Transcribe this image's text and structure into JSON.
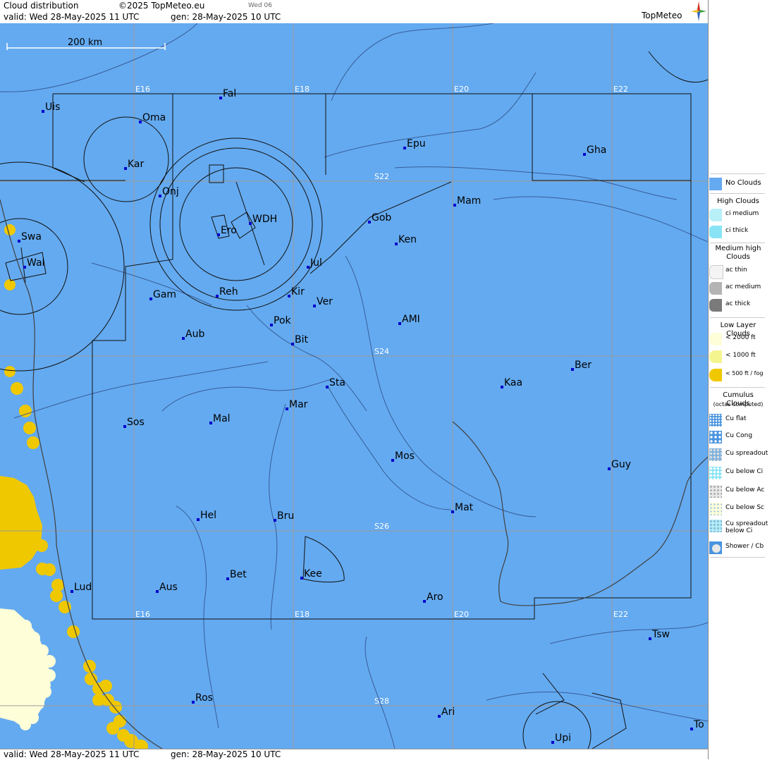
{
  "header": {
    "title": "Cloud distribution",
    "copyright": "©2025 TopMeteo.eu",
    "day_tag": "Wed 06",
    "valid": "valid:  Wed  28-May-2025  11 UTC",
    "gen": "gen: 28-May-2025 10 UTC",
    "logo": "TopMeteo"
  },
  "footer": {
    "valid": "valid:  Wed  28-May-2025  11 UTC",
    "gen": "gen: 28-May-2025 10 UTC"
  },
  "map": {
    "scale_label": "200 km",
    "grid_labels": {
      "lon": [
        "E16",
        "E18",
        "E20",
        "E22"
      ],
      "lat": [
        "S22",
        "S24",
        "S26",
        "S28"
      ]
    },
    "cities": [
      {
        "name": "Uis"
      },
      {
        "name": "Fal"
      },
      {
        "name": "Oma"
      },
      {
        "name": "Epu"
      },
      {
        "name": "Gha"
      },
      {
        "name": "Kar"
      },
      {
        "name": "Onj"
      },
      {
        "name": "Mam"
      },
      {
        "name": "Gob"
      },
      {
        "name": "WDH"
      },
      {
        "name": "Ero"
      },
      {
        "name": "Ken"
      },
      {
        "name": "Swa"
      },
      {
        "name": "Wal"
      },
      {
        "name": "Jul"
      },
      {
        "name": "Gam"
      },
      {
        "name": "Reh"
      },
      {
        "name": "Kir"
      },
      {
        "name": "Ver"
      },
      {
        "name": "Pok"
      },
      {
        "name": "AMI"
      },
      {
        "name": "Aub"
      },
      {
        "name": "Bit"
      },
      {
        "name": "Ber"
      },
      {
        "name": "Sta"
      },
      {
        "name": "Kaa"
      },
      {
        "name": "Mar"
      },
      {
        "name": "Sos"
      },
      {
        "name": "Mal"
      },
      {
        "name": "Mos"
      },
      {
        "name": "Guy"
      },
      {
        "name": "Mat"
      },
      {
        "name": "Hel"
      },
      {
        "name": "Bru"
      },
      {
        "name": "Bet"
      },
      {
        "name": "Kee"
      },
      {
        "name": "Lud"
      },
      {
        "name": "Aus"
      },
      {
        "name": "Aro"
      },
      {
        "name": "Tsw"
      },
      {
        "name": "Ros"
      },
      {
        "name": "Ari"
      },
      {
        "name": "Upi"
      },
      {
        "name": "To"
      }
    ]
  },
  "legend": {
    "no_clouds": "No Clouds",
    "high_title": "High Clouds",
    "high": [
      "ci medium",
      "ci thick"
    ],
    "medium_title": "Medium high Clouds",
    "medium": [
      "ac thin",
      "ac medium",
      "ac thick"
    ],
    "low_title": "Low Layer Clouds",
    "low": [
      "< 2000 ft",
      "< 1000 ft",
      "< 500 ft / fog"
    ],
    "cumulus_title": "Cumulus Clouds",
    "cumulus_sub": "(octas computed)",
    "cumulus": [
      "Cu flat",
      "Cu Cong",
      "Cu spreadout",
      "Cu below Ci",
      "Cu below Ac",
      "Cu below Sc",
      "Cu spreadout below Ci",
      "Shower / Cb"
    ]
  },
  "colors": {
    "sea_blue": "#64aaf0",
    "grid": "#9a9a9a",
    "low_2000": "#fefed8",
    "low_1000": "#f5f590",
    "low_500": "#f0c800",
    "city_marker": "#0000cc"
  }
}
